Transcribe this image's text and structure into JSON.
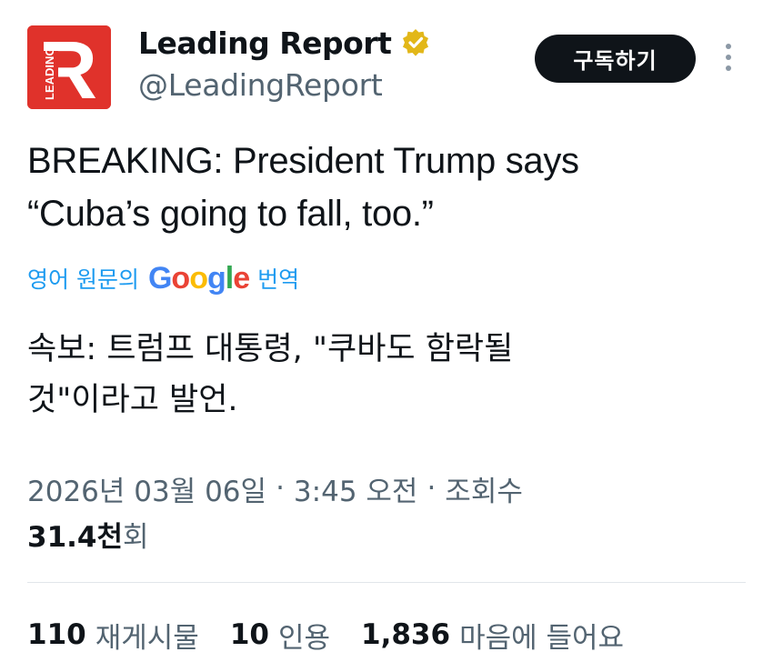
{
  "author": {
    "display_name": "Leading Report",
    "handle": "@LeadingReport",
    "verified": true,
    "avatar_letter": "R",
    "avatar_side_text": "LEADING",
    "avatar_color": "#e0322b"
  },
  "actions": {
    "subscribe_label": "구독하기",
    "more_icon": "more-vertical-icon"
  },
  "tweet": {
    "text_lines": [
      "BREAKING: President Trump says",
      "“Cuba’s going to fall, too.”"
    ],
    "translate": {
      "prefix": "영어 원문의",
      "google_letters": [
        "G",
        "o",
        "o",
        "g",
        "l",
        "e"
      ],
      "suffix": "번역"
    },
    "translated_lines": [
      "속보: 트럼프 대통령, \"쿠바도 함락될",
      "것\"이라고 발언."
    ]
  },
  "meta": {
    "date": "2026년 03월 06일",
    "time": "3:45 오전",
    "views_label": "조회수",
    "separator": "·",
    "views_count": "31.4천",
    "views_suffix": "회"
  },
  "stats": {
    "reposts_count": "110",
    "reposts_label": "재게시물",
    "quotes_count": "10",
    "quotes_label": "인용",
    "likes_count": "1,836",
    "likes_label": "마음에 들어요"
  },
  "colors": {
    "accent_blue": "#1d9bf0",
    "verified_gold": "#e2b719",
    "button_bg": "#0f1419",
    "secondary_text": "#536471"
  }
}
